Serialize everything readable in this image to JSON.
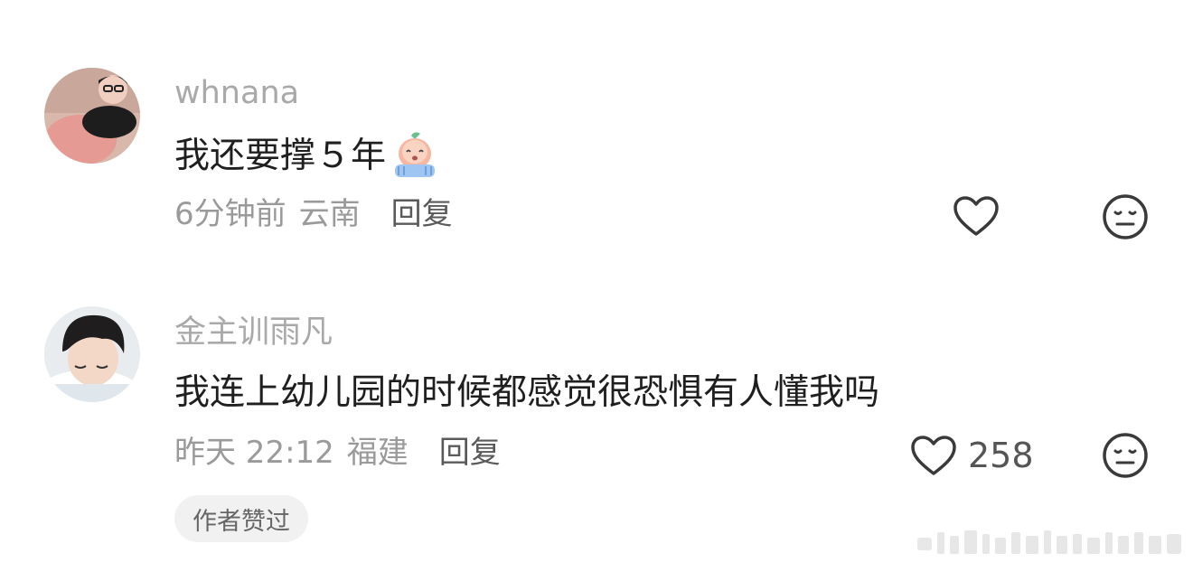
{
  "comments": [
    {
      "username": "whnana",
      "text": "我还要撑５年",
      "emoji": "crying-peach-emoji",
      "time": "6分钟前",
      "location": "云南",
      "reply_label": "回复",
      "likes": "",
      "like_icon": "heart-outline-icon",
      "dislike_icon": "neutral-face-icon"
    },
    {
      "username": "金主训雨凡",
      "text": "我连上幼儿园的时候都感觉很恐惧有人懂我吗",
      "time": "昨天 22:12",
      "location": "福建",
      "reply_label": "回复",
      "likes": "258",
      "like_icon": "heart-outline-icon",
      "dislike_icon": "neutral-face-icon",
      "badge": "作者赞过"
    }
  ],
  "colors": {
    "username": "#a9a9a9",
    "text": "#1f1f1f",
    "meta": "#9a9a9a",
    "reply": "#5a5a5a",
    "badge_bg": "#f1f1f1"
  }
}
